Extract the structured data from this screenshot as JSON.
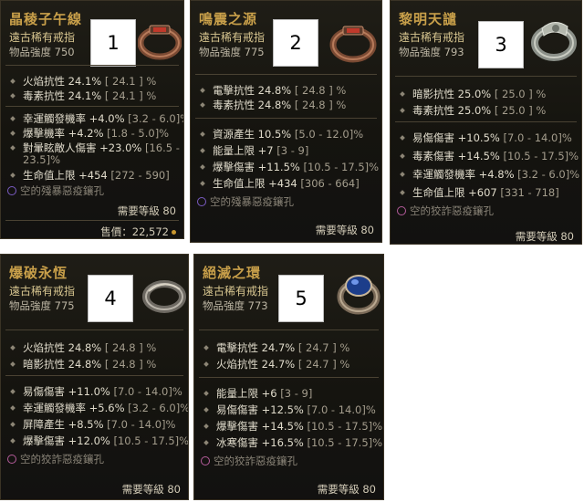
{
  "cards": [
    {
      "title": "晶稜子午線",
      "type": "遠古稀有戒指",
      "power": "物品強度 750",
      "number": "1",
      "ring_icon": "ring-icon",
      "stats_a": [
        {
          "label": "火焰抗性 24.1%",
          "range": "[ 24.1 ] %"
        },
        {
          "label": "毒素抗性 24.1%",
          "range": "[ 24.1 ] %"
        }
      ],
      "stats_b": [
        {
          "label": "幸運觸發機率 +4.0%",
          "range": "[3.2 - 6.0]%"
        },
        {
          "label": "爆擊機率 +4.2%",
          "range": "[1.8 - 5.0]%"
        },
        {
          "label": "對暈眩敵人傷害 +23.0%",
          "range": "[16.5 -"
        },
        {
          "label": "",
          "range": "23.5]%"
        },
        {
          "label": "生命值上限 +454",
          "range": "[272 - 590]"
        }
      ],
      "socket": "空的殘暴惡疫鑲孔",
      "requirement": "需要等級 80",
      "price": "售價：22,572"
    },
    {
      "title": "鳴震之源",
      "type": "遠古稀有戒指",
      "power": "物品強度 775",
      "number": "2",
      "ring_icon": "ring-icon",
      "stats_a": [
        {
          "label": "電擊抗性 24.8%",
          "range": "[ 24.8 ] %"
        },
        {
          "label": "毒素抗性 24.8%",
          "range": "[ 24.8 ] %"
        }
      ],
      "stats_b": [
        {
          "label": "資源產生 10.5%",
          "range": "[5.0 - 12.0]%"
        },
        {
          "label": "能量上限 +7",
          "range": "[3 - 9]"
        },
        {
          "label": "爆擊傷害 +11.5%",
          "range": "[10.5 - 17.5]%"
        },
        {
          "label": "生命值上限 +434",
          "range": "[306 - 664]"
        }
      ],
      "socket": "空的殘暴惡疫鑲孔",
      "requirement": "需要等級 80"
    },
    {
      "title": "黎明天譴",
      "type": "遠古稀有戒指",
      "power": "物品強度 793",
      "number": "3",
      "ring_icon": "ring-icon",
      "stats_a": [
        {
          "label": "暗影抗性 25.0%",
          "range": "[ 25.0 ] %"
        },
        {
          "label": "毒素抗性 25.0%",
          "range": "[ 25.0 ] %"
        }
      ],
      "stats_b": [
        {
          "label": "易傷傷害 +10.5%",
          "range": "[7.0 - 14.0]%"
        },
        {
          "label": "毒素傷害 +14.5%",
          "range": "[10.5 - 17.5]%"
        },
        {
          "label": "幸運觸發機率 +4.8%",
          "range": "[3.2 - 6.0]%"
        },
        {
          "label": "生命值上限 +607",
          "range": "[331 - 718]"
        }
      ],
      "socket": "空的狡詐惡疫鑲孔",
      "requirement": "需要等級 80"
    },
    {
      "title": "爆破永恆",
      "type": "遠古稀有戒指",
      "power": "物品強度 775",
      "number": "4",
      "ring_icon": "ring-icon",
      "stats_a": [
        {
          "label": "火焰抗性 24.8%",
          "range": "[ 24.8 ] %"
        },
        {
          "label": "暗影抗性 24.8%",
          "range": "[ 24.8 ] %"
        }
      ],
      "stats_b": [
        {
          "label": "易傷傷害 +11.0%",
          "range": "[7.0 - 14.0]%"
        },
        {
          "label": "幸運觸發機率 +5.6%",
          "range": "[3.2 - 6.0]%"
        },
        {
          "label": "屏障產生 +8.5%",
          "range": "[7.0 - 14.0]%"
        },
        {
          "label": "爆擊傷害 +12.0%",
          "range": "[10.5 - 17.5]%"
        }
      ],
      "socket": "空的狡詐惡疫鑲孔",
      "requirement": "需要等級 80"
    },
    {
      "title": "絕滅之環",
      "type": "遠古稀有戒指",
      "power": "物品強度 773",
      "number": "5",
      "ring_icon": "ring-icon",
      "stats_a": [
        {
          "label": "電擊抗性 24.7%",
          "range": "[ 24.7 ] %"
        },
        {
          "label": "火焰抗性 24.7%",
          "range": "[ 24.7 ] %"
        }
      ],
      "stats_b": [
        {
          "label": "能量上限 +6",
          "range": "[3 - 9]"
        },
        {
          "label": "易傷傷害 +12.5%",
          "range": "[7.0 - 14.0]%"
        },
        {
          "label": "爆擊傷害 +14.5%",
          "range": "[10.5 - 17.5]%"
        },
        {
          "label": "冰寒傷害 +16.5%",
          "range": "[10.5 - 17.5]%"
        }
      ],
      "socket": "空的狡詐惡疫鑲孔",
      "requirement": "需要等級 80"
    }
  ]
}
